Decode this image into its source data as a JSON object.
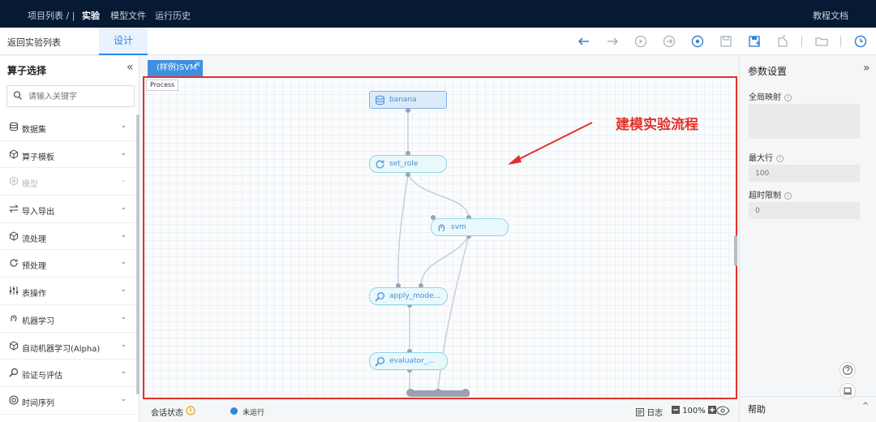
{
  "topnav": {
    "breadcrumb": "项目列表 /  |",
    "menu": [
      "实验",
      "模型文件",
      "运行历史"
    ],
    "docs": "教程文档"
  },
  "toolbar": {
    "back_link": "返回实验列表",
    "tab_design": "设计",
    "icons": [
      "undo-icon",
      "redo-icon",
      "run-icon",
      "run-next-icon",
      "stop-icon",
      "save-icon",
      "save-as-icon",
      "export-icon",
      "folder-icon",
      "history-icon"
    ]
  },
  "left_panel": {
    "title": "算子选择",
    "search_placeholder": "请输入关键字",
    "items": [
      {
        "label": "数据集",
        "icon": "database-icon",
        "disabled": false
      },
      {
        "label": "算子模板",
        "icon": "cube-icon",
        "disabled": false
      },
      {
        "label": "模型",
        "icon": "model-icon",
        "disabled": true
      },
      {
        "label": "导入导出",
        "icon": "import-export-icon",
        "disabled": false
      },
      {
        "label": "流处理",
        "icon": "cube-icon",
        "disabled": false
      },
      {
        "label": "预处理",
        "icon": "refresh-icon",
        "disabled": false
      },
      {
        "label": "表操作",
        "icon": "sliders-icon",
        "disabled": false
      },
      {
        "label": "机器学习",
        "icon": "brain-icon",
        "disabled": false
      },
      {
        "label": "自动机器学习(Alpha)",
        "icon": "cube-icon",
        "disabled": false
      },
      {
        "label": "验证与评估",
        "icon": "magnifier-icon",
        "disabled": false
      },
      {
        "label": "时间序列",
        "icon": "clock-icon",
        "disabled": false
      }
    ]
  },
  "canvas": {
    "tab_label": "(样例)SVM",
    "process_tag": "Process",
    "annotation": "建模实验流程",
    "nodes": [
      {
        "label": "banana",
        "icon": "database-icon"
      },
      {
        "label": "set_role",
        "icon": "refresh-icon"
      },
      {
        "label": "svm",
        "icon": "brain-icon"
      },
      {
        "label": "apply_mode...",
        "icon": "magnifier-icon"
      },
      {
        "label": "evaluator_...",
        "icon": "magnifier-icon"
      }
    ]
  },
  "statusbar": {
    "session_label": "会话状态",
    "state": "未运行",
    "log_label": "日志",
    "zoom": "100%"
  },
  "right_panel": {
    "title": "参数设置",
    "global_mapping_label": "全局映射",
    "max_rows_label": "最大行",
    "max_rows_value": "100",
    "timeout_label": "超时限制",
    "timeout_value": "0",
    "help_label": "帮助"
  },
  "colors": {
    "nav_bg": "#061b33",
    "accent": "#2f86e0",
    "annotation_red": "#e2312c",
    "node_border": "#8fd6e6"
  }
}
